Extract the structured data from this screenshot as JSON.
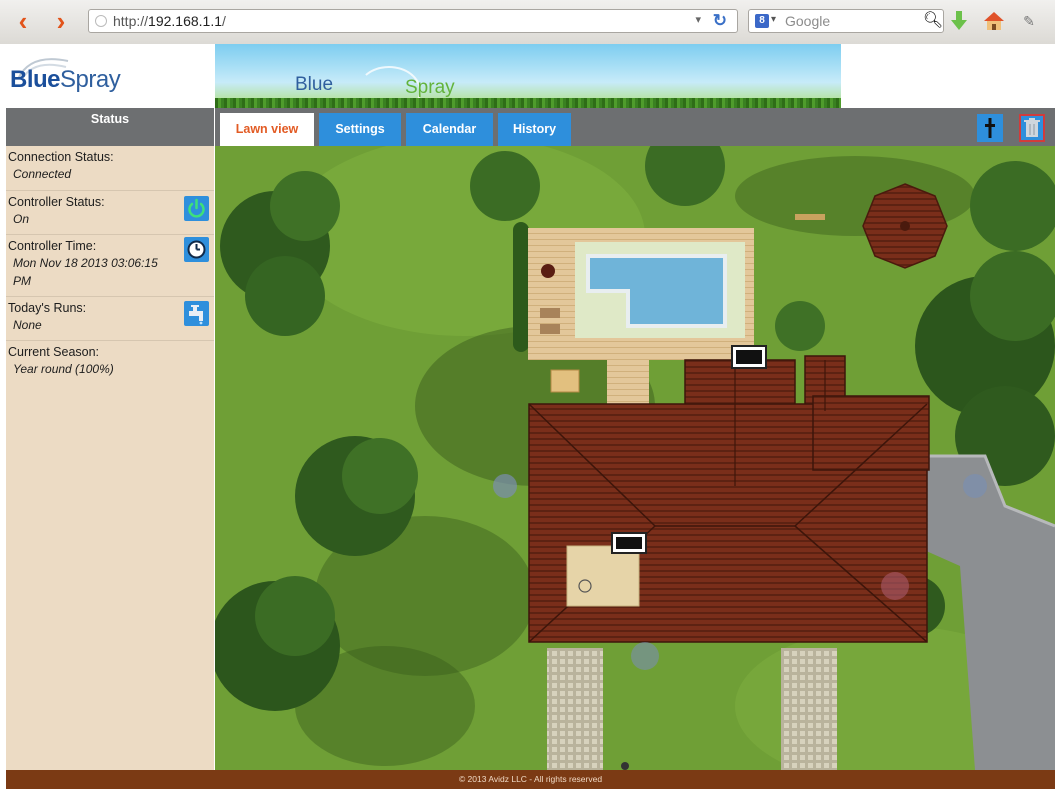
{
  "browser": {
    "url_prefix": "http://",
    "url_host": "192.168.1.1",
    "url_suffix": "/",
    "search_placeholder": "Google",
    "search_engine_glyph": "8"
  },
  "logo": {
    "blue": "Blue",
    "spray": "Spray"
  },
  "banner": {
    "blue": "Blue",
    "spray": "Spray"
  },
  "sidebar": {
    "title": "Status",
    "items": [
      {
        "label": "Connection Status:",
        "value": "Connected"
      },
      {
        "label": "Controller Status:",
        "value": "On",
        "icon": "power-icon"
      },
      {
        "label": "Controller Time:",
        "value": "Mon Nov 18 2013 03:06:15 PM",
        "icon": "clock-icon"
      },
      {
        "label": "Today's Runs:",
        "value": "None",
        "icon": "faucet-icon"
      },
      {
        "label": "Current Season:",
        "value": "Year round (100%)"
      }
    ]
  },
  "tabs": [
    {
      "label": "Lawn view",
      "active": true
    },
    {
      "label": "Settings",
      "active": false
    },
    {
      "label": "Calendar",
      "active": false
    },
    {
      "label": "History",
      "active": false
    }
  ],
  "toolbar_icons": [
    "sprinkler-tool-icon",
    "trash-icon"
  ],
  "colors": {
    "accent_blue": "#2e8fdc",
    "active_tab_text": "#e25b24",
    "header_gray": "#6d6f71",
    "sidebar_bg": "#ecdbc4",
    "footer_bg": "#7b3a14",
    "power_green": "#35c16a"
  },
  "footer": {
    "copyright": "© 2013 Avidz LLC - All rights reserved"
  }
}
